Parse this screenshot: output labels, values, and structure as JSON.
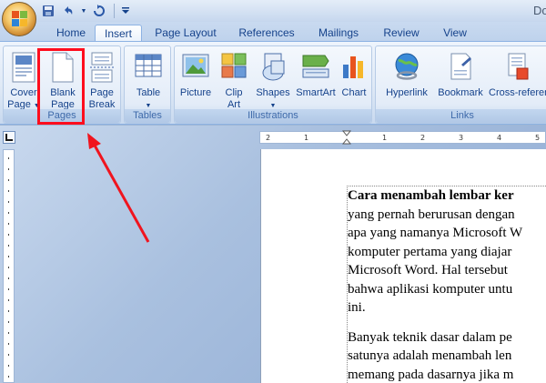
{
  "window": {
    "title": "Do"
  },
  "quick_access": {
    "items": [
      "save-icon",
      "undo-icon",
      "undo-dropdown-icon",
      "redo-icon",
      "customize-qat-icon"
    ]
  },
  "tabs": [
    {
      "label": "Home"
    },
    {
      "label": "Insert",
      "active": true
    },
    {
      "label": "Page Layout"
    },
    {
      "label": "References"
    },
    {
      "label": "Mailings"
    },
    {
      "label": "Review"
    },
    {
      "label": "View"
    }
  ],
  "ribbon": {
    "pages_group": {
      "label": "Pages",
      "cover_page": {
        "line1": "Cover",
        "line2": "Page"
      },
      "blank_page": {
        "line1": "Blank",
        "line2": "Page"
      },
      "page_break": {
        "line1": "Page",
        "line2": "Break"
      }
    },
    "tables_group": {
      "label": "Tables",
      "table": {
        "line1": "Table"
      }
    },
    "illustrations_group": {
      "label": "Illustrations",
      "picture": {
        "line1": "Picture"
      },
      "clip_art": {
        "line1": "Clip",
        "line2": "Art"
      },
      "shapes": {
        "line1": "Shapes"
      },
      "smartart": {
        "line1": "SmartArt"
      },
      "chart": {
        "line1": "Chart"
      }
    },
    "links_group": {
      "label": "Links",
      "hyperlink": {
        "line1": "Hyperlink"
      },
      "bookmark": {
        "line1": "Bookmark"
      },
      "cross_reference": {
        "line1": "Cross-referen"
      }
    }
  },
  "ruler": {
    "horizontal_ticks": [
      "2",
      "1",
      "1",
      "2",
      "3",
      "4",
      "5"
    ]
  },
  "document": {
    "paragraph1": [
      "Cara menambah lembar ker",
      "yang pernah berurusan dengan",
      "apa yang namanya Microsoft W",
      "komputer pertama yang diajar",
      "Microsoft Word. Hal tersebut",
      "bahwa aplikasi komputer untu",
      "ini."
    ],
    "paragraph2": [
      "Banyak teknik dasar dalam pe",
      "satunya adalah menambah len",
      "memang pada dasarnya jika m"
    ]
  },
  "colors": {
    "highlight": "#ff0d1d",
    "ribbon_text": "#15428b",
    "workspace": "#9eb6d4"
  }
}
